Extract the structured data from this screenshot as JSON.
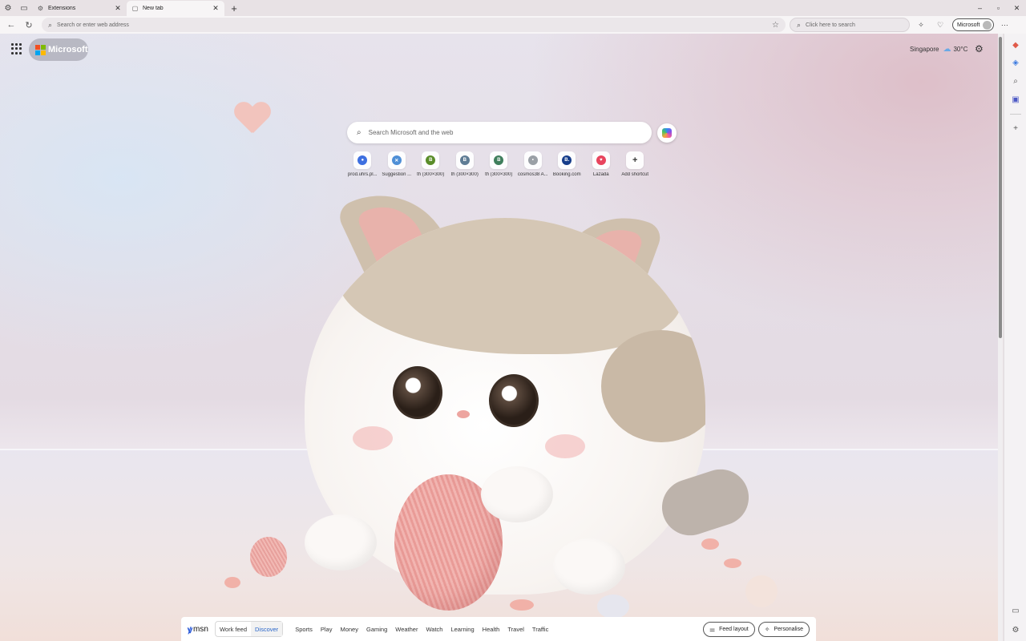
{
  "tabs": [
    {
      "title": "Extensions",
      "close": "✕"
    },
    {
      "title": "New tab",
      "close": "✕"
    }
  ],
  "new_tab_symbol": "+",
  "window_controls": {
    "minimize": "–",
    "maximize": "▫",
    "close": "✕"
  },
  "address_bar": {
    "placeholder": "Search or enter web address"
  },
  "side_search": {
    "placeholder": "Click here to search"
  },
  "profile": {
    "label": "Microsoft"
  },
  "page": {
    "brand": "Microsoft",
    "weather": {
      "city": "Singapore",
      "temp": "30°C"
    },
    "search_placeholder": "Search Microsoft and the web"
  },
  "shortcuts": [
    {
      "label": "prod.uhrs.pl...",
      "icon": "●",
      "color": "#3d6fe0"
    },
    {
      "label": "Suggestion ...",
      "icon": "✕",
      "color": "#4f8fd6"
    },
    {
      "label": "th (300×300)",
      "icon": "B",
      "color": "#5a8d2a"
    },
    {
      "label": "th (300×300)",
      "icon": "B",
      "color": "#5f7c95"
    },
    {
      "label": "th (300×300)",
      "icon": "B",
      "color": "#3f7e5c"
    },
    {
      "label": "cosmos38 A...",
      "icon": "•",
      "color": "#9aa0a6"
    },
    {
      "label": "Booking.com",
      "icon": "B.",
      "color": "#163d8a"
    },
    {
      "label": "Lazada",
      "icon": "♥",
      "color": "#e8445d"
    },
    {
      "label": "Add shortcut",
      "icon": "+",
      "color": "#ffffff"
    }
  ],
  "msn": {
    "logo": "msn",
    "tabs": [
      "Work feed",
      "Discover"
    ],
    "selected_tab": "Discover",
    "links": [
      "Sports",
      "Play",
      "Money",
      "Gaming",
      "Weather",
      "Watch",
      "Learning",
      "Health",
      "Travel",
      "Traffic"
    ],
    "feed_layout": "Feed layout",
    "personalise": "Personalise"
  },
  "colors": {
    "ms_red": "#f25022",
    "ms_green": "#7fba00",
    "ms_blue": "#00a4ef",
    "ms_yellow": "#ffb900",
    "accent": "#2a66c9"
  },
  "icons": [
    "settings-icon",
    "sidebar-toggle-icon",
    "back-icon",
    "refresh-icon",
    "search-icon",
    "favorite-star-icon",
    "extensions-icon",
    "collections-icon",
    "more-icon",
    "copilot-icon",
    "apps-grid-icon",
    "gear-icon",
    "add-icon"
  ]
}
